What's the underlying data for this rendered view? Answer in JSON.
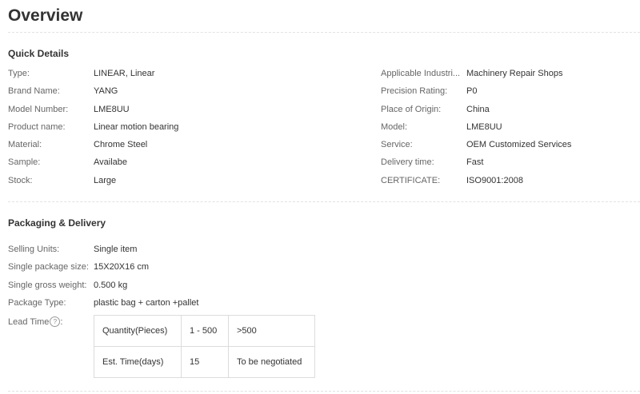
{
  "title": "Overview",
  "quick_details": {
    "heading": "Quick Details",
    "left": [
      {
        "key": "Type:",
        "value": "LINEAR, Linear"
      },
      {
        "key": "Brand Name:",
        "value": "YANG"
      },
      {
        "key": "Model Number:",
        "value": "LME8UU"
      },
      {
        "key": "Product name:",
        "value": "Linear motion bearing"
      },
      {
        "key": "Material:",
        "value": "Chrome Steel"
      },
      {
        "key": "Sample:",
        "value": "Availabe"
      },
      {
        "key": "Stock:",
        "value": "Large"
      }
    ],
    "right": [
      {
        "key": "Applicable Industri...",
        "value": "Machinery Repair Shops"
      },
      {
        "key": "Precision Rating:",
        "value": "P0"
      },
      {
        "key": "Place of Origin:",
        "value": "China"
      },
      {
        "key": "Model:",
        "value": "LME8UU"
      },
      {
        "key": "Service:",
        "value": "OEM Customized Services"
      },
      {
        "key": "Delivery time:",
        "value": "Fast"
      },
      {
        "key": "CERTIFICATE:",
        "value": "ISO9001:2008"
      }
    ]
  },
  "packaging": {
    "heading": "Packaging & Delivery",
    "items": [
      {
        "key": "Selling Units:",
        "value": "Single item"
      },
      {
        "key": "Single package size:",
        "value": "15X20X16 cm"
      },
      {
        "key": "Single gross weight:",
        "value": "0.500 kg"
      },
      {
        "key": "Package Type:",
        "value": "plastic bag + carton +pallet"
      }
    ],
    "lead_time_label": "Lead Time",
    "help_glyph": "?",
    "lead_table": {
      "row1": [
        "Quantity(Pieces)",
        "1 - 500",
        ">500"
      ],
      "row2": [
        "Est. Time(days)",
        "15",
        "To be negotiated"
      ]
    }
  }
}
